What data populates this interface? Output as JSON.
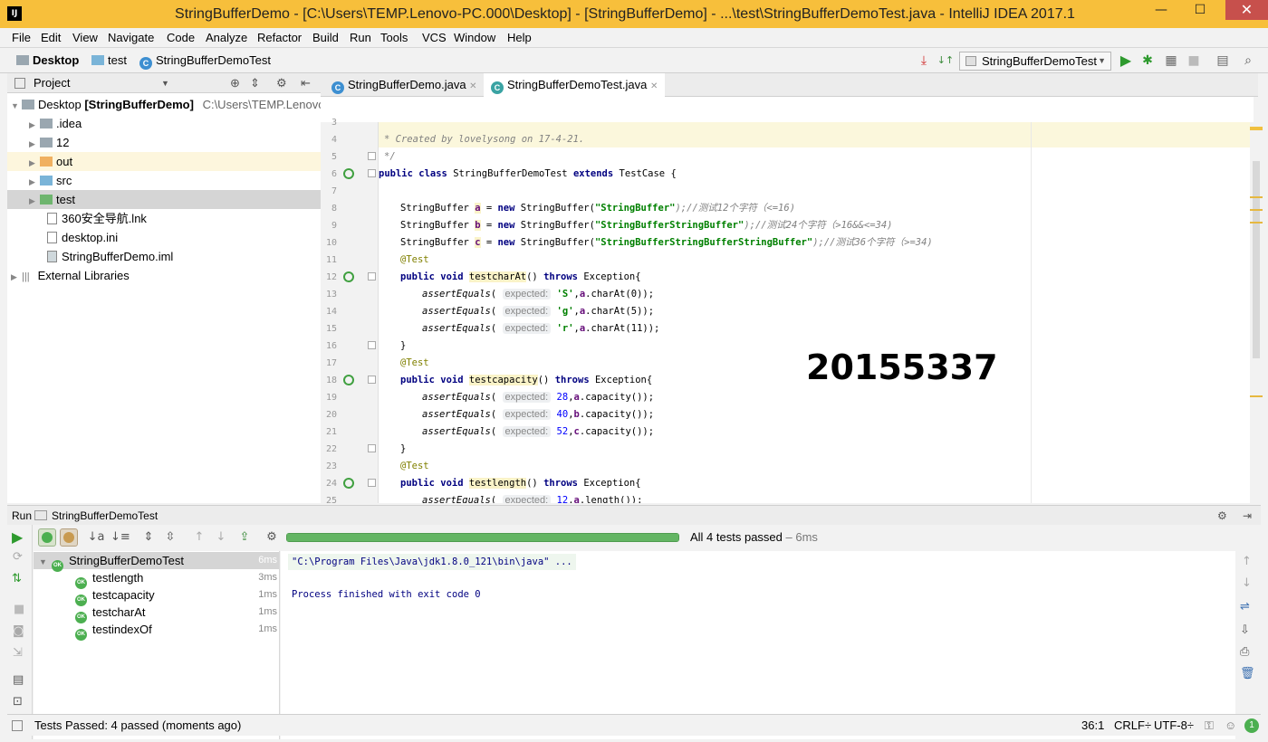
{
  "window": {
    "title": "StringBufferDemo - [C:\\Users\\TEMP.Lenovo-PC.000\\Desktop] - [StringBufferDemo] - ...\\test\\StringBufferDemoTest.java - IntelliJ IDEA 2017.1",
    "app_icon": "IJ",
    "minimize": "—",
    "maximize": "☐",
    "close": "✕"
  },
  "menu": [
    "File",
    "Edit",
    "View",
    "Navigate",
    "Code",
    "Analyze",
    "Refactor",
    "Build",
    "Run",
    "Tools",
    "VCS",
    "Window",
    "Help"
  ],
  "breadcrumb": {
    "root": "Desktop",
    "folder": "test",
    "file": "StringBufferDemoTest"
  },
  "run_config": {
    "selected": "StringBufferDemoTest"
  },
  "project_panel": {
    "title": "Project",
    "root_label": "Desktop",
    "root_module": "[StringBufferDemo]",
    "root_path": "C:\\Users\\TEMP.Lenovo",
    "items": [
      ".idea",
      "12",
      "out",
      "src",
      "test",
      "360安全导航.lnk",
      "desktop.ini",
      "StringBufferDemo.iml"
    ],
    "external": "External Libraries"
  },
  "editor": {
    "tabs": [
      "StringBufferDemo.java",
      "StringBufferDemoTest.java"
    ],
    "active_tab": 1,
    "line_numbers": [
      "3",
      "4",
      "5",
      "6",
      "7",
      "8",
      "9",
      "10",
      "11",
      "12",
      "13",
      "14",
      "15",
      "16",
      "17",
      "18",
      "19",
      "20",
      "21",
      "22",
      "23",
      "24",
      "25"
    ],
    "comment_created": "* Created by lovelysong on 17-4-21.",
    "comment_close": "*/",
    "class_decl_kw1": "public class",
    "class_name": "StringBufferDemoTest",
    "class_decl_kw2": "extends",
    "class_super": "TestCase {",
    "sb_type": "StringBuffer",
    "var_a": "a",
    "var_b": "b",
    "var_c": "c",
    "eq_new": " = ",
    "kw_new": "new",
    "ctor": " StringBuffer(",
    "str_a": "\"StringBuffer\"",
    "str_b": "\"StringBufferStringBuffer\"",
    "str_c": "\"StringBufferStringBufferStringBuffer\"",
    "cmt_a": ");//测试12个字符（<=16)",
    "cmt_b": ");//测试24个字符（>16&&<=34)",
    "cmt_c": ");//测试36个字符（>=34)",
    "annotation": "@Test",
    "pub_void": "public void",
    "m1": "testcharAt",
    "m2": "testcapacity",
    "m3": "testlength",
    "throws_kw": "throws",
    "exc": "Exception{",
    "paren": "()",
    "assert": "assertEquals",
    "hint_expected": "expected:",
    "chr_S": "'S'",
    "chr_g": "'g'",
    "chr_r": "'r'",
    "charAt_0": "charAt(0));",
    "charAt_5": "charAt(5));",
    "charAt_11": "charAt(11));",
    "cap": "capacity());",
    "len": "length());",
    "n28": "28",
    "n40": "40",
    "n52": "52",
    "n12": "12",
    "close_brace": "}",
    "open_paren": "(",
    "comma_a": ",a.",
    "comma_b": ",b.",
    "comma_c": ",c.",
    "watermark": "20155337"
  },
  "run_panel": {
    "label": "Run",
    "config": "StringBufferDemoTest",
    "status": "All 4 tests passed",
    "status_time": " – 6ms",
    "progress": 1.0,
    "root_test": "StringBufferDemoTest",
    "root_time": "6ms",
    "tests": [
      {
        "name": "testlength",
        "time": "3ms"
      },
      {
        "name": "testcapacity",
        "time": "1ms"
      },
      {
        "name": "testcharAt",
        "time": "1ms"
      },
      {
        "name": "testindexOf",
        "time": "1ms"
      }
    ],
    "console_cmd": "\"C:\\Program Files\\Java\\jdk1.8.0_121\\bin\\java\" ...",
    "console_exit": "Process finished with exit code 0",
    "ok_badge": "OK"
  },
  "status_bar": {
    "message": "Tests Passed: 4 passed (moments ago)",
    "position": "36:1",
    "line_sep": "CRLF÷",
    "encoding": "UTF-8÷",
    "badge": "1"
  },
  "colors": {
    "title_bar": "#f7bf3b",
    "accent_green": "#4caf50",
    "close_red": "#c7504c"
  }
}
